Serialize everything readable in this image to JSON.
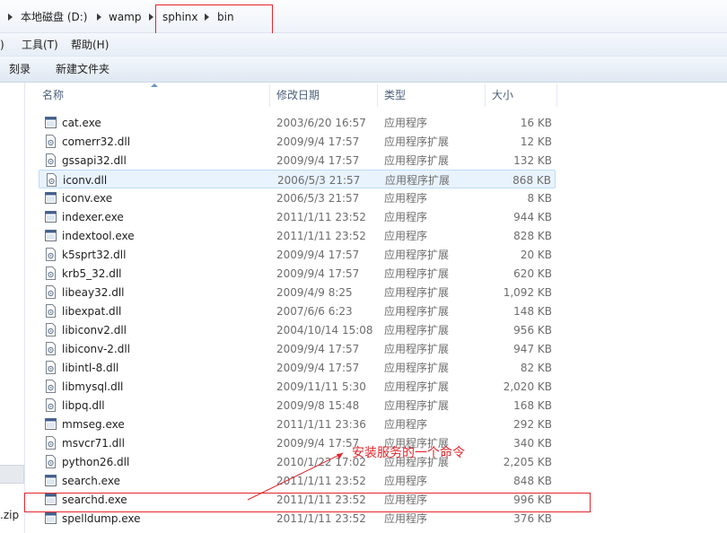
{
  "address": {
    "crumbs": [
      "本地磁盘 (D:)",
      "wamp",
      "sphinx",
      "bin"
    ]
  },
  "menu": {
    "items": [
      ")",
      "工具(T)",
      "帮助(H)"
    ]
  },
  "toolbar": {
    "burn": "刻录",
    "new_folder": "新建文件夹"
  },
  "nav": {
    "zip_label": ".zip"
  },
  "columns": {
    "name": "名称",
    "date": "修改日期",
    "type": "类型",
    "size": "大小"
  },
  "files": [
    {
      "name": "cat.exe",
      "date": "2003/6/20 16:57",
      "type": "应用程序",
      "size": "16 KB",
      "kind": "exe"
    },
    {
      "name": "comerr32.dll",
      "date": "2009/9/4 17:57",
      "type": "应用程序扩展",
      "size": "12 KB",
      "kind": "dll"
    },
    {
      "name": "gssapi32.dll",
      "date": "2009/9/4 17:57",
      "type": "应用程序扩展",
      "size": "132 KB",
      "kind": "dll"
    },
    {
      "name": "iconv.dll",
      "date": "2006/5/3 21:57",
      "type": "应用程序扩展",
      "size": "868 KB",
      "kind": "dll"
    },
    {
      "name": "iconv.exe",
      "date": "2006/5/3 21:57",
      "type": "应用程序",
      "size": "8 KB",
      "kind": "exe"
    },
    {
      "name": "indexer.exe",
      "date": "2011/1/11 23:52",
      "type": "应用程序",
      "size": "944 KB",
      "kind": "exe"
    },
    {
      "name": "indextool.exe",
      "date": "2011/1/11 23:52",
      "type": "应用程序",
      "size": "828 KB",
      "kind": "exe"
    },
    {
      "name": "k5sprt32.dll",
      "date": "2009/9/4 17:57",
      "type": "应用程序扩展",
      "size": "20 KB",
      "kind": "dll"
    },
    {
      "name": "krb5_32.dll",
      "date": "2009/9/4 17:57",
      "type": "应用程序扩展",
      "size": "620 KB",
      "kind": "dll"
    },
    {
      "name": "libeay32.dll",
      "date": "2009/4/9 8:25",
      "type": "应用程序扩展",
      "size": "1,092 KB",
      "kind": "dll"
    },
    {
      "name": "libexpat.dll",
      "date": "2007/6/6 6:23",
      "type": "应用程序扩展",
      "size": "148 KB",
      "kind": "dll"
    },
    {
      "name": "libiconv2.dll",
      "date": "2004/10/14 15:08",
      "type": "应用程序扩展",
      "size": "956 KB",
      "kind": "dll"
    },
    {
      "name": "libiconv-2.dll",
      "date": "2009/9/4 17:57",
      "type": "应用程序扩展",
      "size": "947 KB",
      "kind": "dll"
    },
    {
      "name": "libintl-8.dll",
      "date": "2009/9/4 17:57",
      "type": "应用程序扩展",
      "size": "82 KB",
      "kind": "dll"
    },
    {
      "name": "libmysql.dll",
      "date": "2009/11/11 5:30",
      "type": "应用程序扩展",
      "size": "2,020 KB",
      "kind": "dll"
    },
    {
      "name": "libpq.dll",
      "date": "2009/9/8 15:48",
      "type": "应用程序扩展",
      "size": "168 KB",
      "kind": "dll"
    },
    {
      "name": "mmseg.exe",
      "date": "2011/1/11 23:36",
      "type": "应用程序",
      "size": "292 KB",
      "kind": "exe"
    },
    {
      "name": "msvcr71.dll",
      "date": "2009/9/4 17:57",
      "type": "应用程序扩展",
      "size": "340 KB",
      "kind": "dll"
    },
    {
      "name": "python26.dll",
      "date": "2010/1/22 17:02",
      "type": "应用程序扩展",
      "size": "2,205 KB",
      "kind": "dll"
    },
    {
      "name": "search.exe",
      "date": "2011/1/11 23:52",
      "type": "应用程序",
      "size": "848 KB",
      "kind": "exe"
    },
    {
      "name": "searchd.exe",
      "date": "2011/1/11 23:52",
      "type": "应用程序",
      "size": "996 KB",
      "kind": "exe"
    },
    {
      "name": "spelldump.exe",
      "date": "2011/1/11 23:52",
      "type": "应用程序",
      "size": "376 KB",
      "kind": "exe"
    }
  ],
  "hover_index": 3,
  "annotation": {
    "text": "安装服务的一个命令",
    "color": "#e2252b"
  }
}
